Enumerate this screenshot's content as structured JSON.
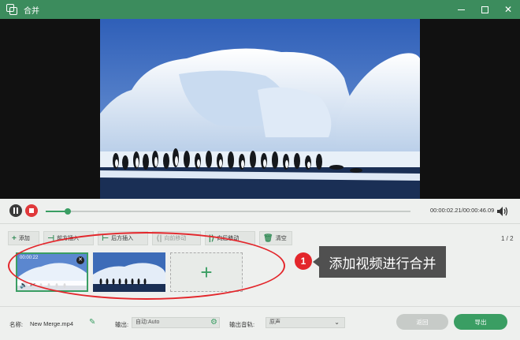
{
  "window": {
    "title": "合并",
    "controls": [
      "minimize",
      "maximize",
      "close"
    ]
  },
  "player": {
    "progress": 0.06,
    "time": "00:00:02.21/00:00:46.09"
  },
  "toolbar": {
    "add": "添加",
    "insert_before": "前方插入",
    "insert_after": "后方插入",
    "move_forward": "向前移动",
    "move_backward": "向后移动",
    "clear": "清空",
    "page": "1 / 2"
  },
  "clips": [
    {
      "duration": "00:00:22",
      "selected": true
    },
    {
      "duration": "",
      "selected": false
    }
  ],
  "annotation": {
    "badge": "1",
    "callout": "添加视频进行合并"
  },
  "footer": {
    "name_label": "名称:",
    "name_value": "New Merge.mp4",
    "output_label": "输出:",
    "output_value": "自动:Auto",
    "track_label": "输出音轨:",
    "track_value": "原声",
    "return_label": "返回",
    "export_label": "导出"
  },
  "colors": {
    "titlebar": "#3c8c5d",
    "accent": "#3a9e63",
    "annotation": "#e3262b"
  }
}
